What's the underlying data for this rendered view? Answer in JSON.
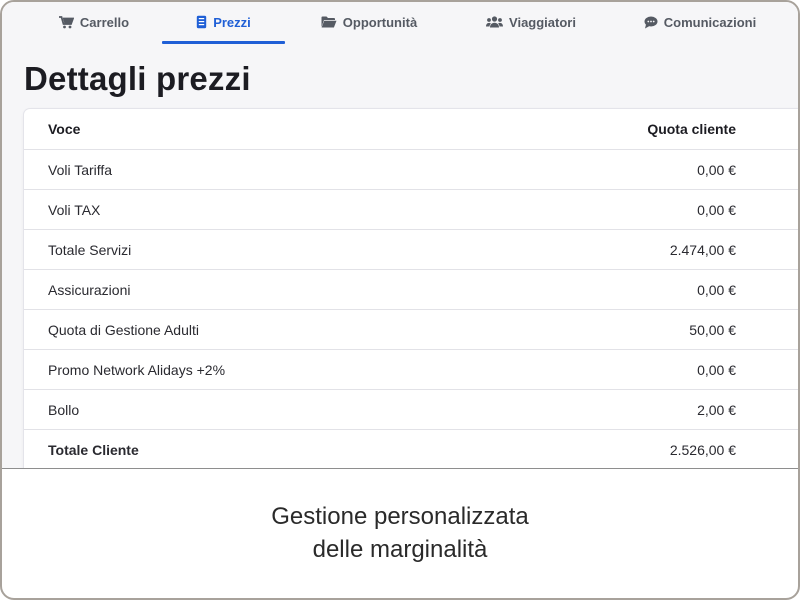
{
  "tabs": [
    {
      "label": "Carrello",
      "icon": "cart-icon",
      "active": false
    },
    {
      "label": "Prezzi",
      "icon": "receipt-icon",
      "active": true
    },
    {
      "label": "Opportunità",
      "icon": "folder-icon",
      "active": false
    },
    {
      "label": "Viaggiatori",
      "icon": "users-icon",
      "active": false
    },
    {
      "label": "Comunicazioni",
      "icon": "chat-icon",
      "active": false
    }
  ],
  "page_title": "Dettagli prezzi",
  "table": {
    "headers": {
      "voce": "Voce",
      "quota": "Quota cliente"
    },
    "rows": [
      {
        "voce": "Voli Tariffa",
        "quota": "0,00 €"
      },
      {
        "voce": "Voli TAX",
        "quota": "0,00 €"
      },
      {
        "voce": "Totale Servizi",
        "quota": "2.474,00 €"
      },
      {
        "voce": "Assicurazioni",
        "quota": "0,00 €"
      },
      {
        "voce": "Quota di Gestione Adulti",
        "quota": "50,00 €"
      },
      {
        "voce": "Promo Network Alidays +2%",
        "quota": "0,00 €"
      },
      {
        "voce": "Bollo",
        "quota": "2,00 €"
      },
      {
        "voce": "Totale Cliente",
        "quota": "2.526,00 €"
      }
    ]
  },
  "caption": {
    "line1": "Gestione personalizzata",
    "line2": "delle marginalità"
  },
  "colors": {
    "accent": "#1f5fd6",
    "text": "#1c1c22",
    "frame": "#a8a29b"
  }
}
